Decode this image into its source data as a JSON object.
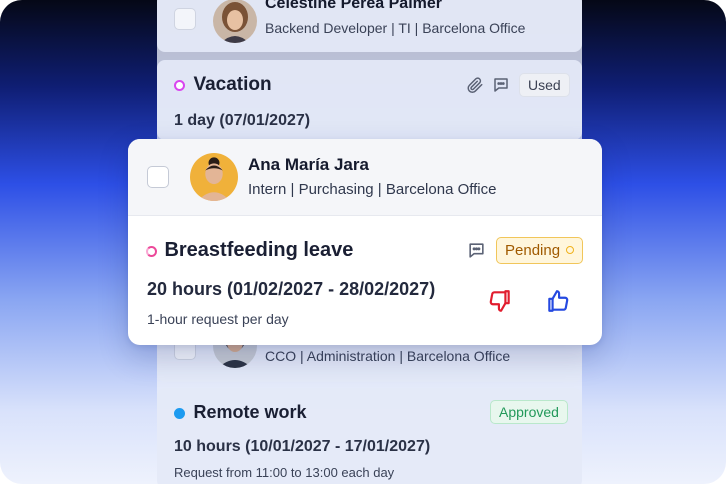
{
  "background_person": {
    "name": "Célestine Perea Palmer",
    "meta": "Backend Developer | TI | Barcelona Office"
  },
  "vacation_card": {
    "type_label": "Vacation",
    "type_color": "#d946ef",
    "status": "Used",
    "detail": "1 day (07/01/2027)"
  },
  "front_card": {
    "person": {
      "name": "Ana María Jara",
      "meta": "Intern | Purchasing | Barcelona Office"
    },
    "request": {
      "type_label": "Breastfeeding leave",
      "type_color": "#ec4899",
      "status": "Pending",
      "detail": "20 hours (01/02/2027 - 28/02/2027)",
      "note": "1-hour request per day"
    }
  },
  "bottom_person": {
    "meta": "CCO | Administration | Barcelona Office"
  },
  "remote_card": {
    "type_label": "Remote work",
    "type_color": "#1d9bf0",
    "status": "Approved",
    "detail": "10 hours (10/01/2027 - 17/01/2027)",
    "note": "Request from 11:00 to 13:00 each day"
  },
  "colors": {
    "reject": "#e11d2e",
    "approve": "#2549e0",
    "pending_accent": "#f0b21c",
    "approved_accent": "#22995a"
  },
  "icons": [
    "paperclip-icon",
    "comment-icon",
    "thumbs-down-icon",
    "thumbs-up-icon"
  ]
}
